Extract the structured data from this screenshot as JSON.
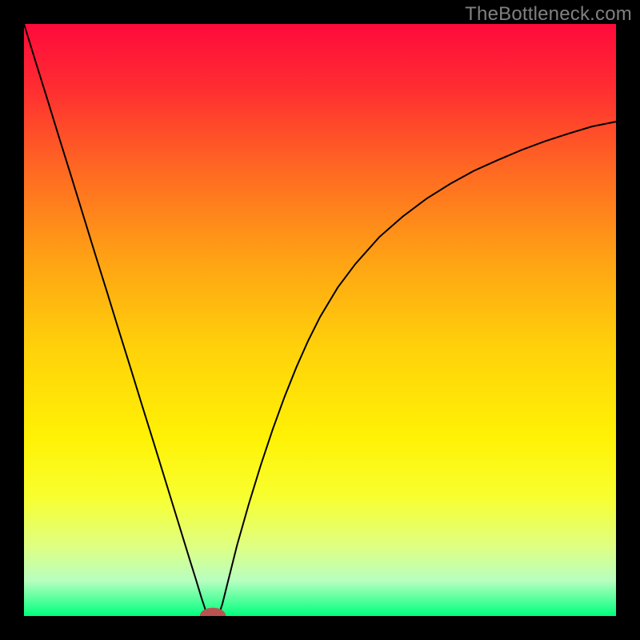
{
  "watermark": "TheBottleneck.com",
  "chart_data": {
    "type": "line",
    "title": "",
    "xlabel": "",
    "ylabel": "",
    "x_domain": [
      0,
      100
    ],
    "y_domain": [
      0,
      100
    ],
    "background_gradient": {
      "orientation": "vertical",
      "stops": [
        {
          "offset": 0.0,
          "color": "#ff0a3c"
        },
        {
          "offset": 0.1,
          "color": "#ff2a32"
        },
        {
          "offset": 0.25,
          "color": "#ff6a22"
        },
        {
          "offset": 0.4,
          "color": "#ffa314"
        },
        {
          "offset": 0.55,
          "color": "#ffd20a"
        },
        {
          "offset": 0.7,
          "color": "#fff205"
        },
        {
          "offset": 0.8,
          "color": "#f8ff30"
        },
        {
          "offset": 0.88,
          "color": "#e0ff80"
        },
        {
          "offset": 0.94,
          "color": "#b8ffc0"
        },
        {
          "offset": 1.0,
          "color": "#00ff7e"
        }
      ]
    },
    "series": [
      {
        "name": "left-branch",
        "color": "#000000",
        "width": 2.0,
        "x": [
          0,
          2,
          4,
          6,
          8,
          10,
          12,
          14,
          16,
          18,
          20,
          22,
          24,
          26,
          28,
          29,
          30,
          30.5,
          30.8
        ],
        "y": [
          100,
          93.5,
          87.1,
          80.6,
          74.2,
          67.7,
          61.2,
          54.8,
          48.3,
          41.9,
          35.4,
          29.0,
          22.5,
          16.0,
          9.5,
          6.3,
          3.0,
          1.5,
          0.5
        ]
      },
      {
        "name": "right-branch",
        "color": "#000000",
        "width": 2.0,
        "x": [
          33.0,
          33.5,
          34,
          35,
          36,
          38,
          40,
          42,
          44,
          46,
          48,
          50,
          53,
          56,
          60,
          64,
          68,
          72,
          76,
          80,
          84,
          88,
          92,
          96,
          100
        ],
        "y": [
          0.5,
          2.0,
          4.0,
          8.0,
          12.0,
          19.0,
          25.5,
          31.5,
          37.0,
          42.0,
          46.5,
          50.5,
          55.5,
          59.5,
          64.0,
          67.5,
          70.5,
          73.0,
          75.2,
          77.0,
          78.7,
          80.2,
          81.5,
          82.7,
          83.5
        ]
      }
    ],
    "marker": {
      "name": "minimum-marker",
      "x_center": 31.9,
      "y_center": 0.0,
      "rx": 2.2,
      "ry": 1.4,
      "fill": "#b85450"
    }
  }
}
